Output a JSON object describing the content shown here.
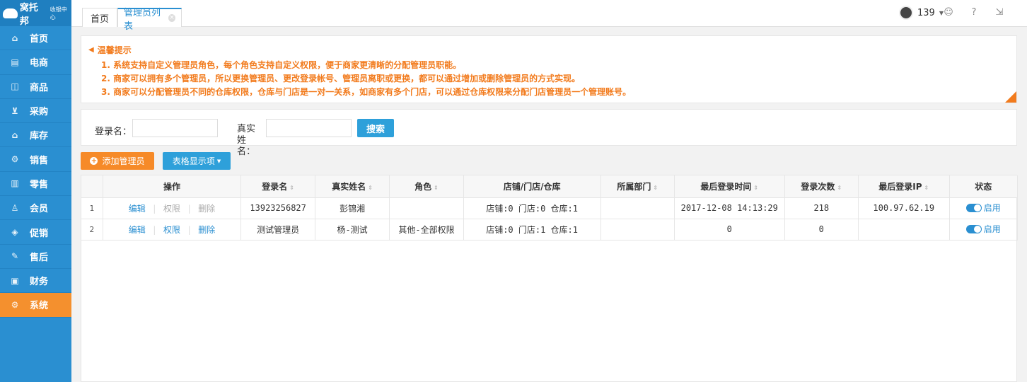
{
  "logo": {
    "brand": "窝托邦",
    "subtitle": "收银中心"
  },
  "sidebar": {
    "items": [
      {
        "label": "首页",
        "icon": "home-icon"
      },
      {
        "label": "电商",
        "icon": "document-icon"
      },
      {
        "label": "商品",
        "icon": "bag-icon"
      },
      {
        "label": "采购",
        "icon": "cart-icon"
      },
      {
        "label": "库存",
        "icon": "warehouse-icon"
      },
      {
        "label": "销售",
        "icon": "gear-icon"
      },
      {
        "label": "零售",
        "icon": "store-icon"
      },
      {
        "label": "会员",
        "icon": "member-icon"
      },
      {
        "label": "促销",
        "icon": "tag-icon"
      },
      {
        "label": "售后",
        "icon": "pen-icon"
      },
      {
        "label": "财务",
        "icon": "wallet-icon"
      },
      {
        "label": "系统",
        "icon": "settings-icon",
        "active": true
      }
    ]
  },
  "tabs": {
    "home": "首页",
    "current": "管理员列表"
  },
  "user": {
    "phone": "139"
  },
  "tip": {
    "title": "温馨提示",
    "lines": [
      "1. 系统支持自定义管理员角色，每个角色支持自定义权限，便于商家更清晰的分配管理员职能。",
      "2. 商家可以拥有多个管理员，所以更换管理员、更改登录帐号、管理员离职或更换，都可以通过增加或删除管理员的方式实现。",
      "3. 商家可以分配管理员不同的仓库权限，仓库与门店是一对一关系，如商家有多个门店，可以通过仓库权限来分配门店管理员一个管理账号。"
    ]
  },
  "search": {
    "login_label": "登录名：",
    "realname_label": "真实姓名：",
    "button": "搜索"
  },
  "actions": {
    "add": "添加管理员",
    "columns": "表格显示项"
  },
  "table": {
    "headers": [
      "操作",
      "登录名",
      "真实姓名",
      "角色",
      "店铺/门店/仓库",
      "所属部门",
      "最后登录时间",
      "登录次数",
      "最后登录IP",
      "状态"
    ],
    "op_labels": {
      "edit": "编辑",
      "perm": "权限",
      "delete": "删除"
    },
    "rows": [
      {
        "idx": "1",
        "login": "13923256827",
        "realname": "彭锦湘",
        "role": "",
        "store": "店铺:0 门店:0 仓库:1",
        "dept": "",
        "last_time": "2017-12-08 14:13:29",
        "count": "218",
        "ip": "100.97.62.19",
        "status": "启用"
      },
      {
        "idx": "2",
        "login": "测试管理员",
        "realname": "杨-测试",
        "role": "其他-全部权限",
        "store": "店铺:0 门店:1 仓库:1",
        "dept": "",
        "last_time": "0",
        "count": "0",
        "ip": "",
        "status": "启用"
      }
    ]
  },
  "colors": {
    "sidebar": "#2a8fd1",
    "active": "#f4902e",
    "tip": "#f27b1d",
    "primary": "#2ea0da",
    "orange_button": "#f68a28"
  }
}
